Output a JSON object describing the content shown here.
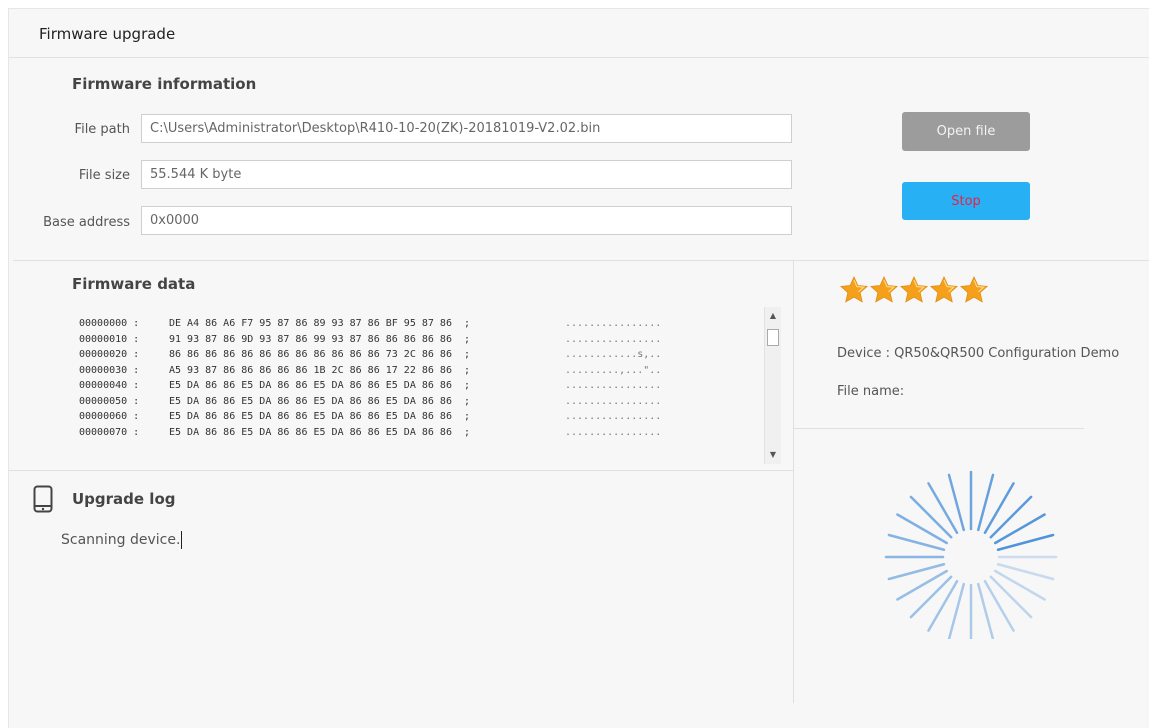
{
  "window": {
    "title": "Firmware upgrade"
  },
  "firmware_info": {
    "section_title": "Firmware information",
    "file_path_label": "File path",
    "file_path_value": "C:\\Users\\Administrator\\Desktop\\R410-10-20(ZK)-20181019-V2.02.bin",
    "file_size_label": "File size",
    "file_size_value": "55.544 K byte",
    "base_address_label": "Base address",
    "base_address_value": "0x0000"
  },
  "buttons": {
    "open_file": "Open file",
    "stop": "Stop"
  },
  "firmware_data": {
    "section_title": "Firmware data",
    "rows": [
      {
        "addr": "00000000 :",
        "bytes": "DE A4 86 A6 F7 95 87 86 89 93 87 86 BF 95 87 86  ;",
        "ascii": "................"
      },
      {
        "addr": "00000010 :",
        "bytes": "91 93 87 86 9D 93 87 86 99 93 87 86 86 86 86 86  ;",
        "ascii": "................"
      },
      {
        "addr": "00000020 :",
        "bytes": "86 86 86 86 86 86 86 86 86 86 86 86 73 2C 86 86  ;",
        "ascii": "............s,.."
      },
      {
        "addr": "00000030 :",
        "bytes": "A5 93 87 86 86 86 86 86 1B 2C 86 86 17 22 86 86  ;",
        "ascii": ".........,...\".."
      },
      {
        "addr": "00000040 :",
        "bytes": "E5 DA 86 86 E5 DA 86 86 E5 DA 86 86 E5 DA 86 86  ;",
        "ascii": "................"
      },
      {
        "addr": "00000050 :",
        "bytes": "E5 DA 86 86 E5 DA 86 86 E5 DA 86 86 E5 DA 86 86  ;",
        "ascii": "................"
      },
      {
        "addr": "00000060 :",
        "bytes": "E5 DA 86 86 E5 DA 86 86 E5 DA 86 86 E5 DA 86 86  ;",
        "ascii": "................"
      },
      {
        "addr": "00000070 :",
        "bytes": "E5 DA 86 86 E5 DA 86 86 E5 DA 86 86 E5 DA 86 86  ;",
        "ascii": "................"
      }
    ]
  },
  "rating": {
    "stars": 5,
    "max": 5,
    "color": "#f5a01a"
  },
  "device_info": {
    "device_line": "Device : QR50&QR500 Configuration Demo",
    "file_name_line": "File name:"
  },
  "upgrade_log": {
    "section_title": "Upgrade log",
    "icon": "tablet-icon",
    "text": "Scanning device."
  },
  "spinner": {
    "icon": "loading-spinner-icon",
    "color": "#4a90d9"
  }
}
